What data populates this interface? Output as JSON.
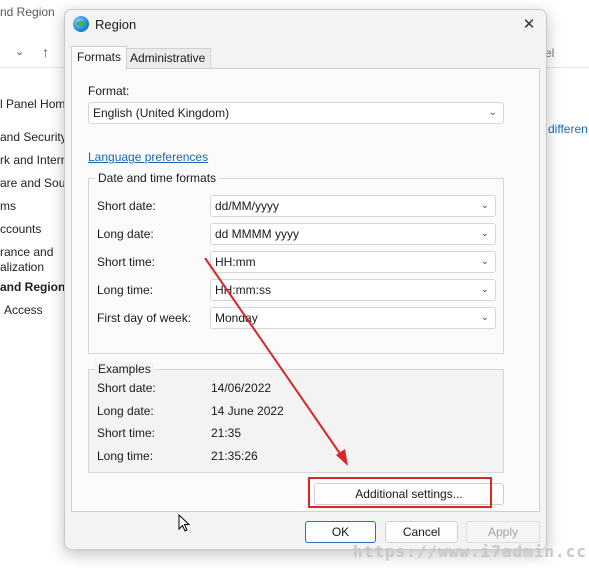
{
  "background": {
    "title_fragment": "nd Region",
    "nav_chevron": "⌄",
    "nav_up": "↑",
    "search_fragment": "el",
    "sidebar": [
      "l Panel Hom",
      "and Security",
      "rk and Intern",
      "are and Soun",
      "ms",
      "ccounts",
      "rance and",
      "alization",
      "and Region",
      "Access"
    ],
    "link_fragment": "differen"
  },
  "dialog": {
    "title": "Region",
    "icon": "globe-icon",
    "close_glyph": "✕",
    "tabs": [
      "Formats",
      "Administrative"
    ],
    "format_label": "Format:",
    "format_value": "English (United Kingdom)",
    "language_preferences": "Language preferences",
    "date_time_group": {
      "title": "Date and time formats",
      "rows": [
        {
          "label": "Short date:",
          "value": "dd/MM/yyyy"
        },
        {
          "label": "Long date:",
          "value": "dd MMMM yyyy"
        },
        {
          "label": "Short time:",
          "value": "HH:mm"
        },
        {
          "label": "Long time:",
          "value": "HH:mm:ss"
        },
        {
          "label": "First day of week:",
          "value": "Monday"
        }
      ]
    },
    "examples": {
      "title": "Examples",
      "rows": [
        {
          "label": "Short date:",
          "value": "14/06/2022"
        },
        {
          "label": "Long date:",
          "value": "14 June 2022"
        },
        {
          "label": "Short time:",
          "value": "21:35"
        },
        {
          "label": "Long time:",
          "value": "21:35:26"
        }
      ]
    },
    "additional_settings": "Additional settings...",
    "ok": "OK",
    "cancel": "Cancel",
    "apply": "Apply"
  },
  "watermark": "https://www.i7admin.cc",
  "colors": {
    "link": "#1b64b5",
    "annotation": "#d62828",
    "primary_border": "#2a6fc0"
  }
}
